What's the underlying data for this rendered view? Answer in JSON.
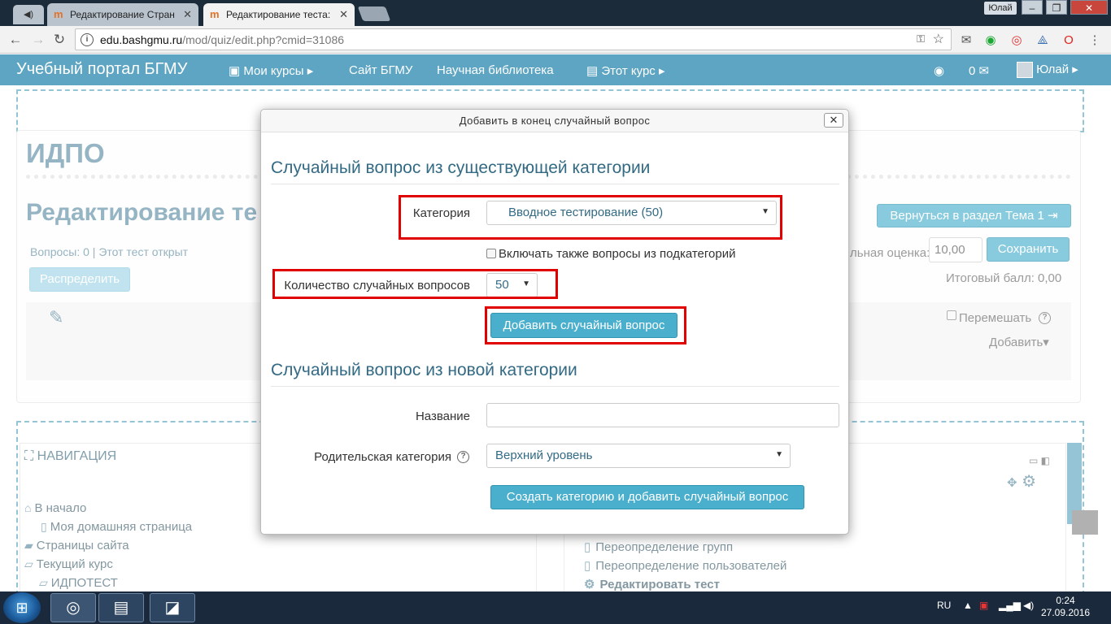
{
  "browser": {
    "tabs": [
      {
        "label": "Редактирование Стран",
        "active": false
      },
      {
        "label": "Редактирование теста: ",
        "active": true
      }
    ],
    "user_chip": "Юлай",
    "url_host": "edu.bashgmu.ru",
    "url_path": "/mod/quiz/edit.php?cmid=31086"
  },
  "navbar": {
    "brand": "Учебный портал БГМУ",
    "my_courses": "Мои курсы",
    "site": "Сайт БГМУ",
    "library": "Научная библиотека",
    "this_course": "Этот курс",
    "messages_count": "0",
    "user": "Юлай"
  },
  "page": {
    "course_name": "ИДПО",
    "title": "Редактирование те",
    "questions_info": "Вопросы: 0 | Этот тест открыт",
    "distribute_button": "Распределить",
    "back_button": "Вернуться в раздел Тема 1",
    "max_grade_label": "льная оценка:",
    "max_grade_value": "10,00",
    "save_button": "Сохранить",
    "total_label": "Итоговый балл: 0,00",
    "shuffle_label": "Перемешать",
    "add_label": "Добавить"
  },
  "navigation": {
    "title": "НАВИГАЦИЯ",
    "items": [
      {
        "label": "В начало"
      },
      {
        "label": "Моя домашняя страница"
      },
      {
        "label": "Страницы сайта"
      },
      {
        "label": "Текущий курс"
      },
      {
        "label": "ИДПОТЕСТ"
      }
    ]
  },
  "settings": {
    "items": [
      {
        "label": "Переопределение групп"
      },
      {
        "label": "Переопределение пользователей"
      },
      {
        "label": "Редактировать тест"
      }
    ]
  },
  "modal": {
    "title": "Добавить в конец случайный вопрос",
    "close": "✕",
    "section1": "Случайный вопрос из существующей категории",
    "category_label": "Категория",
    "category_value": "Вводное тестирование (50)",
    "include_sub_label": "Включать также вопросы из подкатегорий",
    "count_label": "Количество случайных вопросов",
    "count_value": "50",
    "add_random_button": "Добавить случайный вопрос",
    "section2": "Случайный вопрос из новой категории",
    "name_label": "Название",
    "name_value": "",
    "parent_label": "Родительская категория",
    "parent_value": "Верхний уровень",
    "create_button": "Создать категорию и добавить случайный вопрос"
  },
  "taskbar": {
    "lang": "RU",
    "time": "0:24",
    "date": "27.09.2016"
  },
  "colors": {
    "navbar": "#5da5c2",
    "accent_button": "#49afcd",
    "heading": "#336a84",
    "highlight": "#e00000"
  }
}
